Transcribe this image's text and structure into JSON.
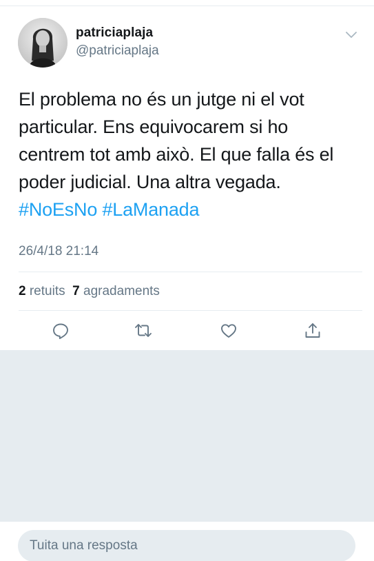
{
  "tweet": {
    "display_name": "patriciaplaja",
    "handle": "@patriciaplaja",
    "text_lines": [
      "El problema no és un jutge ni el vot",
      "particular. Ens equivocarem si ho",
      "centrem tot amb això. El que falla és el",
      "poder judicial. Una altra vegada."
    ],
    "hashtags": [
      "#NoEsNo",
      "#LaManada"
    ],
    "timestamp": "26/4/18 21:14",
    "retweets_count": "2",
    "retweets_label": "retuits",
    "likes_count": "7",
    "likes_label": "agradaments"
  },
  "icons": {
    "caret": "chevron-down-icon",
    "reply": "reply-bubble-icon",
    "retweet": "retweet-icon",
    "like": "heart-icon",
    "share": "share-icon"
  },
  "reply": {
    "placeholder": "Tuita una resposta"
  },
  "colors": {
    "link": "#1da1f2",
    "secondary_text": "#657786",
    "icon": "#657786",
    "background_gray": "#e6ecf0"
  }
}
